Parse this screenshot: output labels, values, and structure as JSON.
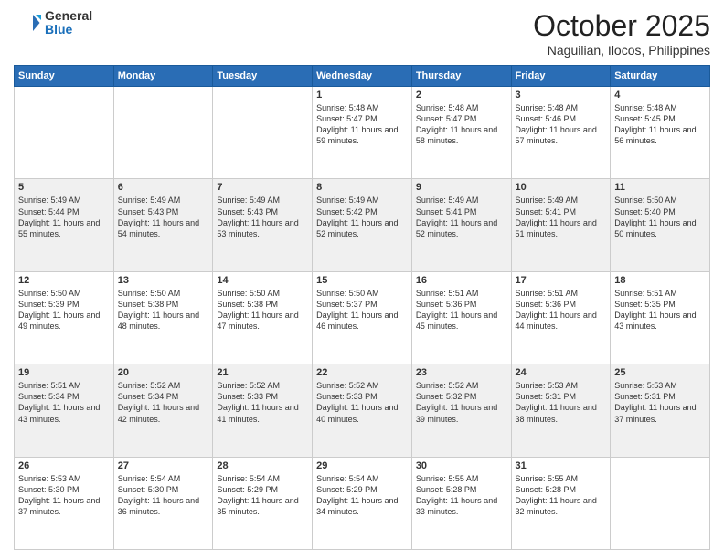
{
  "header": {
    "logo_general": "General",
    "logo_blue": "Blue",
    "month": "October 2025",
    "location": "Naguilian, Ilocos, Philippines"
  },
  "days_of_week": [
    "Sunday",
    "Monday",
    "Tuesday",
    "Wednesday",
    "Thursday",
    "Friday",
    "Saturday"
  ],
  "weeks": [
    [
      {
        "day": "",
        "info": ""
      },
      {
        "day": "",
        "info": ""
      },
      {
        "day": "",
        "info": ""
      },
      {
        "day": "1",
        "info": "Sunrise: 5:48 AM\nSunset: 5:47 PM\nDaylight: 11 hours\nand 59 minutes."
      },
      {
        "day": "2",
        "info": "Sunrise: 5:48 AM\nSunset: 5:47 PM\nDaylight: 11 hours\nand 58 minutes."
      },
      {
        "day": "3",
        "info": "Sunrise: 5:48 AM\nSunset: 5:46 PM\nDaylight: 11 hours\nand 57 minutes."
      },
      {
        "day": "4",
        "info": "Sunrise: 5:48 AM\nSunset: 5:45 PM\nDaylight: 11 hours\nand 56 minutes."
      }
    ],
    [
      {
        "day": "5",
        "info": "Sunrise: 5:49 AM\nSunset: 5:44 PM\nDaylight: 11 hours\nand 55 minutes."
      },
      {
        "day": "6",
        "info": "Sunrise: 5:49 AM\nSunset: 5:43 PM\nDaylight: 11 hours\nand 54 minutes."
      },
      {
        "day": "7",
        "info": "Sunrise: 5:49 AM\nSunset: 5:43 PM\nDaylight: 11 hours\nand 53 minutes."
      },
      {
        "day": "8",
        "info": "Sunrise: 5:49 AM\nSunset: 5:42 PM\nDaylight: 11 hours\nand 52 minutes."
      },
      {
        "day": "9",
        "info": "Sunrise: 5:49 AM\nSunset: 5:41 PM\nDaylight: 11 hours\nand 52 minutes."
      },
      {
        "day": "10",
        "info": "Sunrise: 5:49 AM\nSunset: 5:41 PM\nDaylight: 11 hours\nand 51 minutes."
      },
      {
        "day": "11",
        "info": "Sunrise: 5:50 AM\nSunset: 5:40 PM\nDaylight: 11 hours\nand 50 minutes."
      }
    ],
    [
      {
        "day": "12",
        "info": "Sunrise: 5:50 AM\nSunset: 5:39 PM\nDaylight: 11 hours\nand 49 minutes."
      },
      {
        "day": "13",
        "info": "Sunrise: 5:50 AM\nSunset: 5:38 PM\nDaylight: 11 hours\nand 48 minutes."
      },
      {
        "day": "14",
        "info": "Sunrise: 5:50 AM\nSunset: 5:38 PM\nDaylight: 11 hours\nand 47 minutes."
      },
      {
        "day": "15",
        "info": "Sunrise: 5:50 AM\nSunset: 5:37 PM\nDaylight: 11 hours\nand 46 minutes."
      },
      {
        "day": "16",
        "info": "Sunrise: 5:51 AM\nSunset: 5:36 PM\nDaylight: 11 hours\nand 45 minutes."
      },
      {
        "day": "17",
        "info": "Sunrise: 5:51 AM\nSunset: 5:36 PM\nDaylight: 11 hours\nand 44 minutes."
      },
      {
        "day": "18",
        "info": "Sunrise: 5:51 AM\nSunset: 5:35 PM\nDaylight: 11 hours\nand 43 minutes."
      }
    ],
    [
      {
        "day": "19",
        "info": "Sunrise: 5:51 AM\nSunset: 5:34 PM\nDaylight: 11 hours\nand 43 minutes."
      },
      {
        "day": "20",
        "info": "Sunrise: 5:52 AM\nSunset: 5:34 PM\nDaylight: 11 hours\nand 42 minutes."
      },
      {
        "day": "21",
        "info": "Sunrise: 5:52 AM\nSunset: 5:33 PM\nDaylight: 11 hours\nand 41 minutes."
      },
      {
        "day": "22",
        "info": "Sunrise: 5:52 AM\nSunset: 5:33 PM\nDaylight: 11 hours\nand 40 minutes."
      },
      {
        "day": "23",
        "info": "Sunrise: 5:52 AM\nSunset: 5:32 PM\nDaylight: 11 hours\nand 39 minutes."
      },
      {
        "day": "24",
        "info": "Sunrise: 5:53 AM\nSunset: 5:31 PM\nDaylight: 11 hours\nand 38 minutes."
      },
      {
        "day": "25",
        "info": "Sunrise: 5:53 AM\nSunset: 5:31 PM\nDaylight: 11 hours\nand 37 minutes."
      }
    ],
    [
      {
        "day": "26",
        "info": "Sunrise: 5:53 AM\nSunset: 5:30 PM\nDaylight: 11 hours\nand 37 minutes."
      },
      {
        "day": "27",
        "info": "Sunrise: 5:54 AM\nSunset: 5:30 PM\nDaylight: 11 hours\nand 36 minutes."
      },
      {
        "day": "28",
        "info": "Sunrise: 5:54 AM\nSunset: 5:29 PM\nDaylight: 11 hours\nand 35 minutes."
      },
      {
        "day": "29",
        "info": "Sunrise: 5:54 AM\nSunset: 5:29 PM\nDaylight: 11 hours\nand 34 minutes."
      },
      {
        "day": "30",
        "info": "Sunrise: 5:55 AM\nSunset: 5:28 PM\nDaylight: 11 hours\nand 33 minutes."
      },
      {
        "day": "31",
        "info": "Sunrise: 5:55 AM\nSunset: 5:28 PM\nDaylight: 11 hours\nand 32 minutes."
      },
      {
        "day": "",
        "info": ""
      }
    ]
  ]
}
